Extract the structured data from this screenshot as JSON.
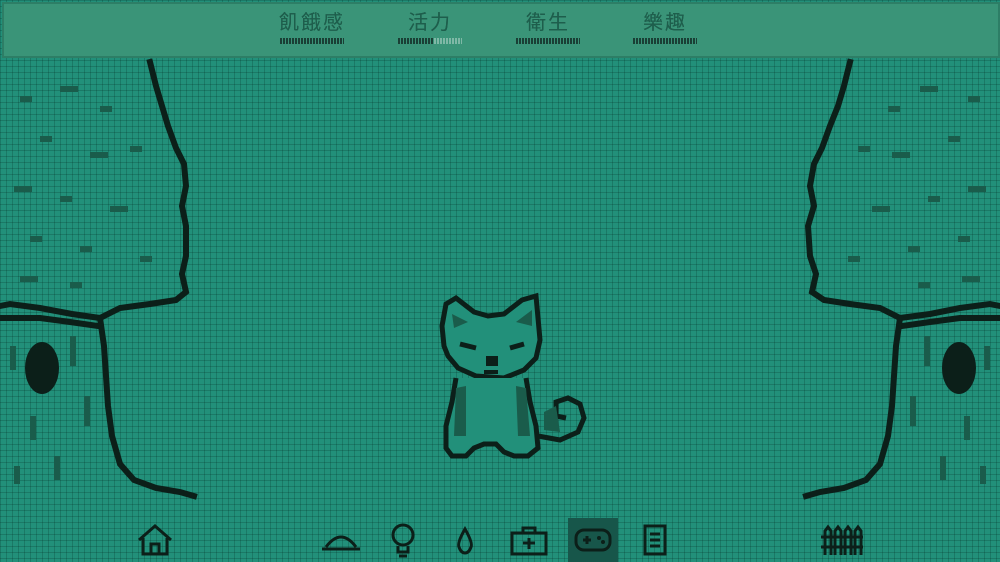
{
  "stats": [
    {
      "label": "飢餓感",
      "level": 1.0
    },
    {
      "label": "活力",
      "level": 0.55
    },
    {
      "label": "衛生",
      "level": 1.0
    },
    {
      "label": "樂趣",
      "level": 1.0
    }
  ],
  "toolbar": {
    "buttons": [
      {
        "icon": "home-icon"
      },
      {
        "icon": "food-bowl-icon"
      },
      {
        "icon": "lightbulb-icon"
      },
      {
        "icon": "water-drop-icon"
      },
      {
        "icon": "medical-kit-icon"
      },
      {
        "icon": "gamepad-icon",
        "active": true
      },
      {
        "icon": "status-card-icon"
      },
      {
        "icon": "fence-icon"
      }
    ]
  },
  "colors": {
    "screen": "#22907a",
    "ink": "#0c1f19",
    "bar": "#3a9478"
  }
}
